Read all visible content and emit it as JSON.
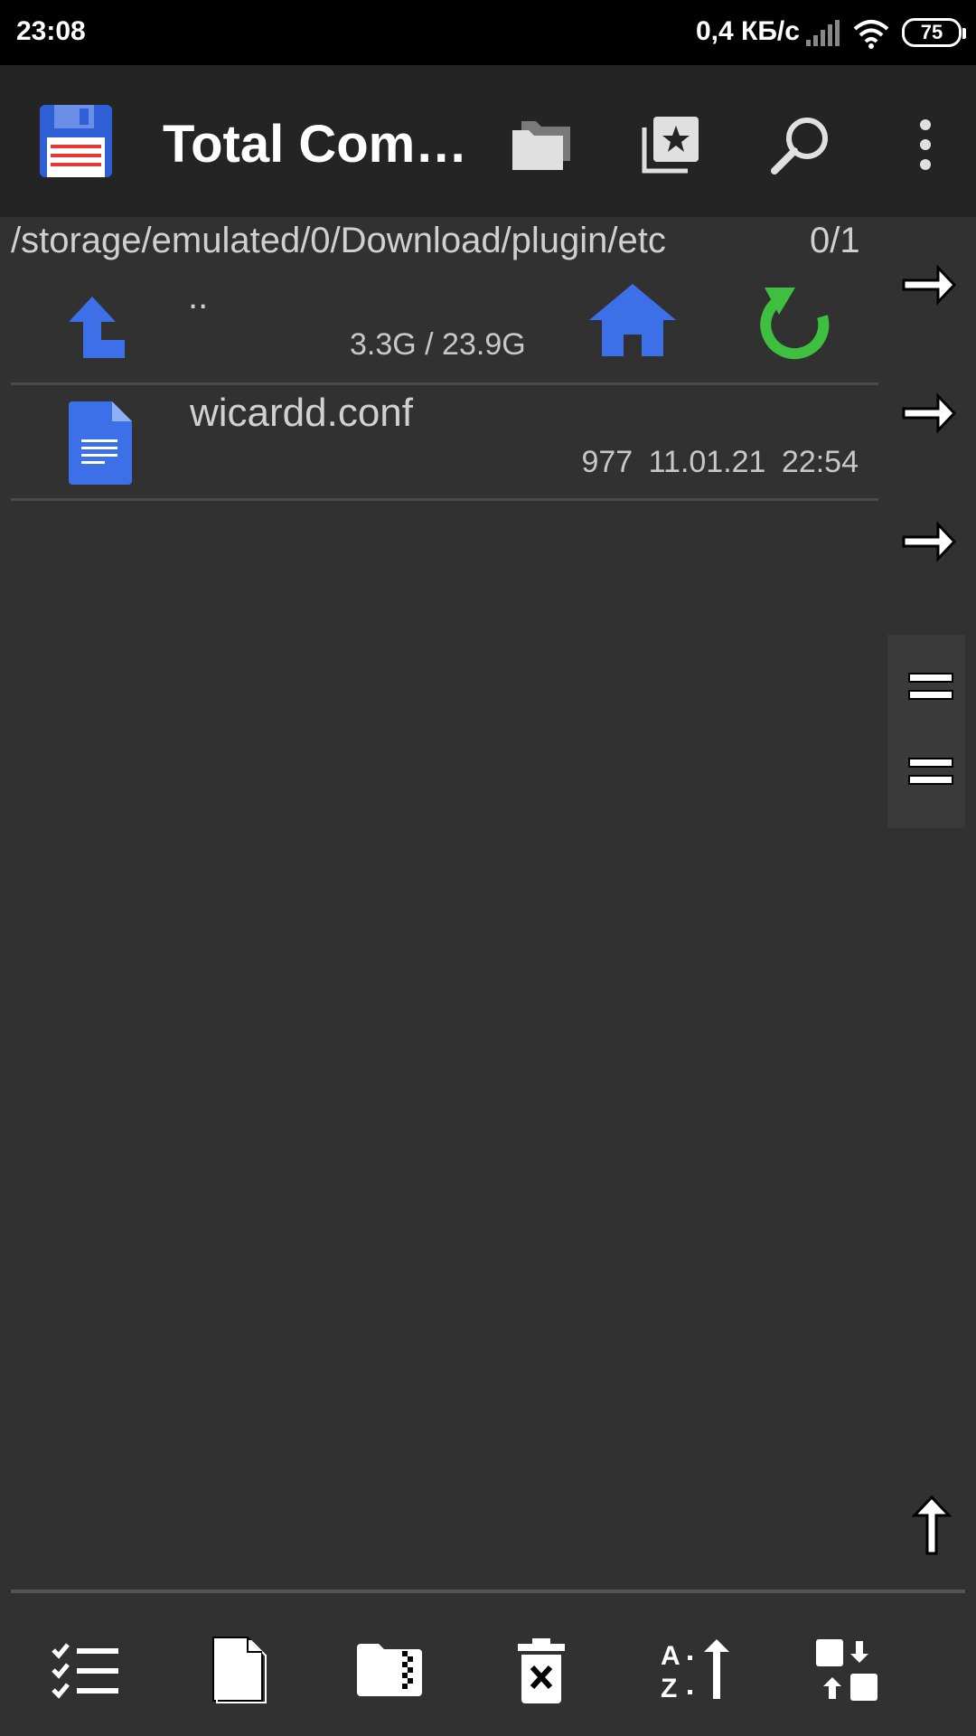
{
  "status_bar": {
    "time": "23:08",
    "net_speed": "0,4 КБ/с",
    "battery": "75"
  },
  "toolbar": {
    "title": "Total Com…",
    "icons": [
      "floppy-logo-icon",
      "folders-icon",
      "bookmarks-icon",
      "search-icon",
      "more-icon"
    ]
  },
  "panel": {
    "path": "/storage/emulated/0/Download/plugin/etc",
    "selection_count": "0/1",
    "up_row": {
      "name": "..",
      "free_space": "3.3G / 23.9G"
    },
    "files": [
      {
        "name": "wicardd.conf",
        "meta": "977  11.01.21  22:54"
      }
    ]
  },
  "colors": {
    "background": "#313131",
    "toolbar": "#242424",
    "accent_blue": "#3d6fe8",
    "refresh_green": "#3fbf3f"
  },
  "bottom_bar": {
    "icons": [
      "select-icon",
      "new-file-icon",
      "zip-folder-icon",
      "delete-icon",
      "sort-icon",
      "swap-panels-icon"
    ]
  }
}
